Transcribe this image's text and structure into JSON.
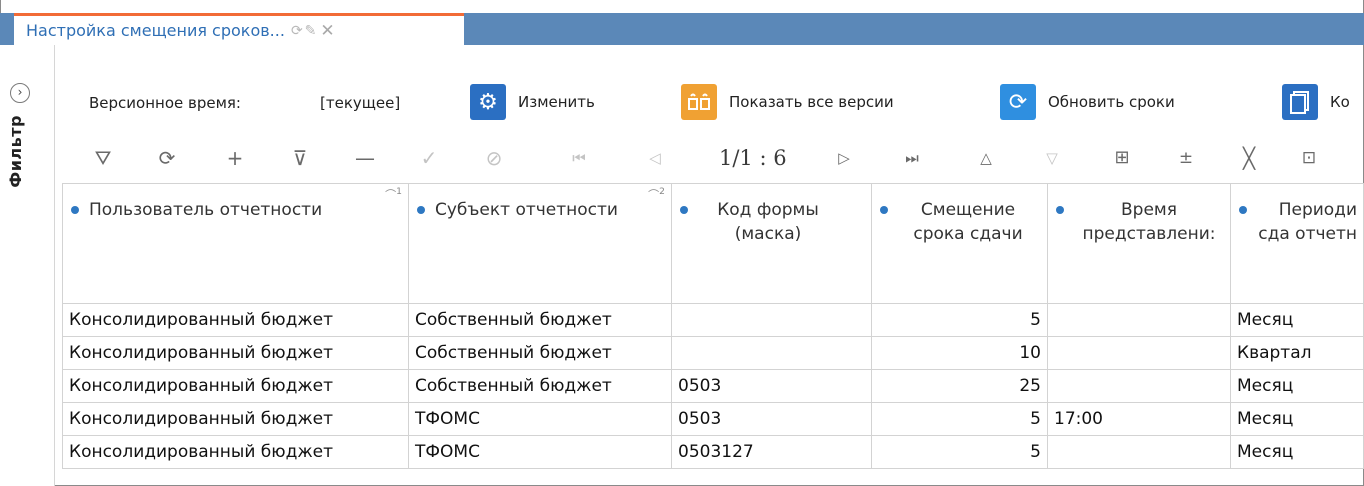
{
  "tab": {
    "title": "Настройка смещения сроков..."
  },
  "sidebar": {
    "label": "Фильтр"
  },
  "actionbar": {
    "version_label": "Версионное время:",
    "version_value": "[текущее]",
    "buttons": [
      {
        "label": "Изменить",
        "icon": "gear-icon",
        "color": "#2b6fc2"
      },
      {
        "label": "Показать все версии",
        "icon": "versions-icon",
        "color": "#f0a133"
      },
      {
        "label": "Обновить сроки",
        "icon": "refresh-icon",
        "color": "#2f8fe0"
      },
      {
        "label": "Ко",
        "icon": "copy-icon",
        "color": "#2b6fc2"
      }
    ]
  },
  "pager": {
    "text": "1/1 : 6"
  },
  "table": {
    "columns": [
      {
        "label": "Пользователь отчетности",
        "sort": "1"
      },
      {
        "label": "Субъект отчетности",
        "sort": "2"
      },
      {
        "label": "Код формы (маска)",
        "sort": ""
      },
      {
        "label": "Смещение срока сдачи",
        "sort": ""
      },
      {
        "label": "Время представлени:",
        "sort": ""
      },
      {
        "label": "Периоди сда отчетн",
        "sort": ""
      }
    ],
    "rows": [
      [
        "Консолидированный бюджет ",
        "Собственный бюджет ",
        "",
        "5",
        "",
        "Месяц"
      ],
      [
        "Консолидированный бюджет ",
        "Собственный бюджет ",
        "",
        "10",
        "",
        "Квартал"
      ],
      [
        "Консолидированный бюджет ",
        "Собственный бюджет ",
        "0503",
        "25",
        "",
        "Месяц"
      ],
      [
        "Консолидированный бюджет ",
        "ТФОМС",
        "0503",
        "5",
        "17:00",
        "Месяц"
      ],
      [
        "Консолидированный бюджет ",
        "ТФОМС",
        "0503127",
        "5",
        "",
        "Месяц"
      ]
    ]
  }
}
